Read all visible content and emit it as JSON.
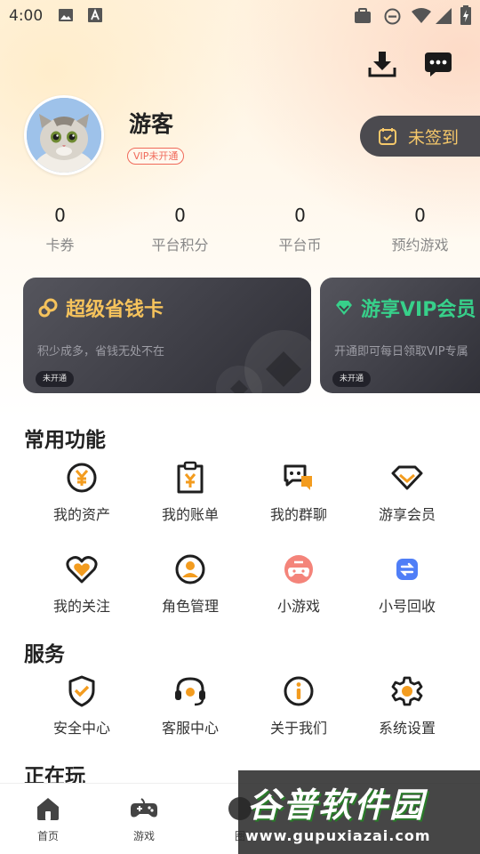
{
  "status_bar": {
    "time": "4:00"
  },
  "profile": {
    "username": "游客",
    "vip_badge": "VIP未开通",
    "signin_label": "未签到"
  },
  "stats": [
    {
      "value": "0",
      "label": "卡券"
    },
    {
      "value": "0",
      "label": "平台积分"
    },
    {
      "value": "0",
      "label": "平台币"
    },
    {
      "value": "0",
      "label": "预约游戏"
    }
  ],
  "cards": [
    {
      "title": "超级省钱卡",
      "desc": "积少成多，省钱无处不在",
      "tag": "未开通",
      "title_color": "#f6c35c",
      "icon": "link-icon"
    },
    {
      "title": "游享VIP会员",
      "desc": "开通即可每日领取VIP专属",
      "tag": "未开通",
      "title_color": "#37d08a",
      "icon": "diamond-icon"
    }
  ],
  "sections": {
    "common": {
      "title": "常用功能",
      "items": [
        {
          "label": "我的资产",
          "icon": "yen-coin-icon"
        },
        {
          "label": "我的账单",
          "icon": "bill-icon"
        },
        {
          "label": "我的群聊",
          "icon": "group-chat-icon"
        },
        {
          "label": "游享会员",
          "icon": "vip-diamond-icon"
        },
        {
          "label": "我的关注",
          "icon": "heart-icon"
        },
        {
          "label": "角色管理",
          "icon": "user-icon"
        },
        {
          "label": "小游戏",
          "icon": "gamepad-icon"
        },
        {
          "label": "小号回收",
          "icon": "recycle-icon"
        }
      ]
    },
    "service": {
      "title": "服务",
      "items": [
        {
          "label": "安全中心",
          "icon": "shield-icon"
        },
        {
          "label": "客服中心",
          "icon": "headset-icon"
        },
        {
          "label": "关于我们",
          "icon": "info-icon"
        },
        {
          "label": "系统设置",
          "icon": "gear-icon"
        }
      ]
    },
    "playing": {
      "title": "正在玩"
    }
  },
  "bottom_nav": [
    {
      "label": "首页",
      "icon": "home-icon"
    },
    {
      "label": "游戏",
      "icon": "gamepad-icon"
    },
    {
      "label": "圈",
      "icon": "circle-icon"
    }
  ],
  "watermark": {
    "logo": "谷普软件园",
    "url": "www.gupuxiazai.com"
  },
  "colors": {
    "accent": "#f39c1f",
    "card_gold": "#f6c35c",
    "card_green": "#37d08a",
    "badge_red": "#f06a5a"
  }
}
